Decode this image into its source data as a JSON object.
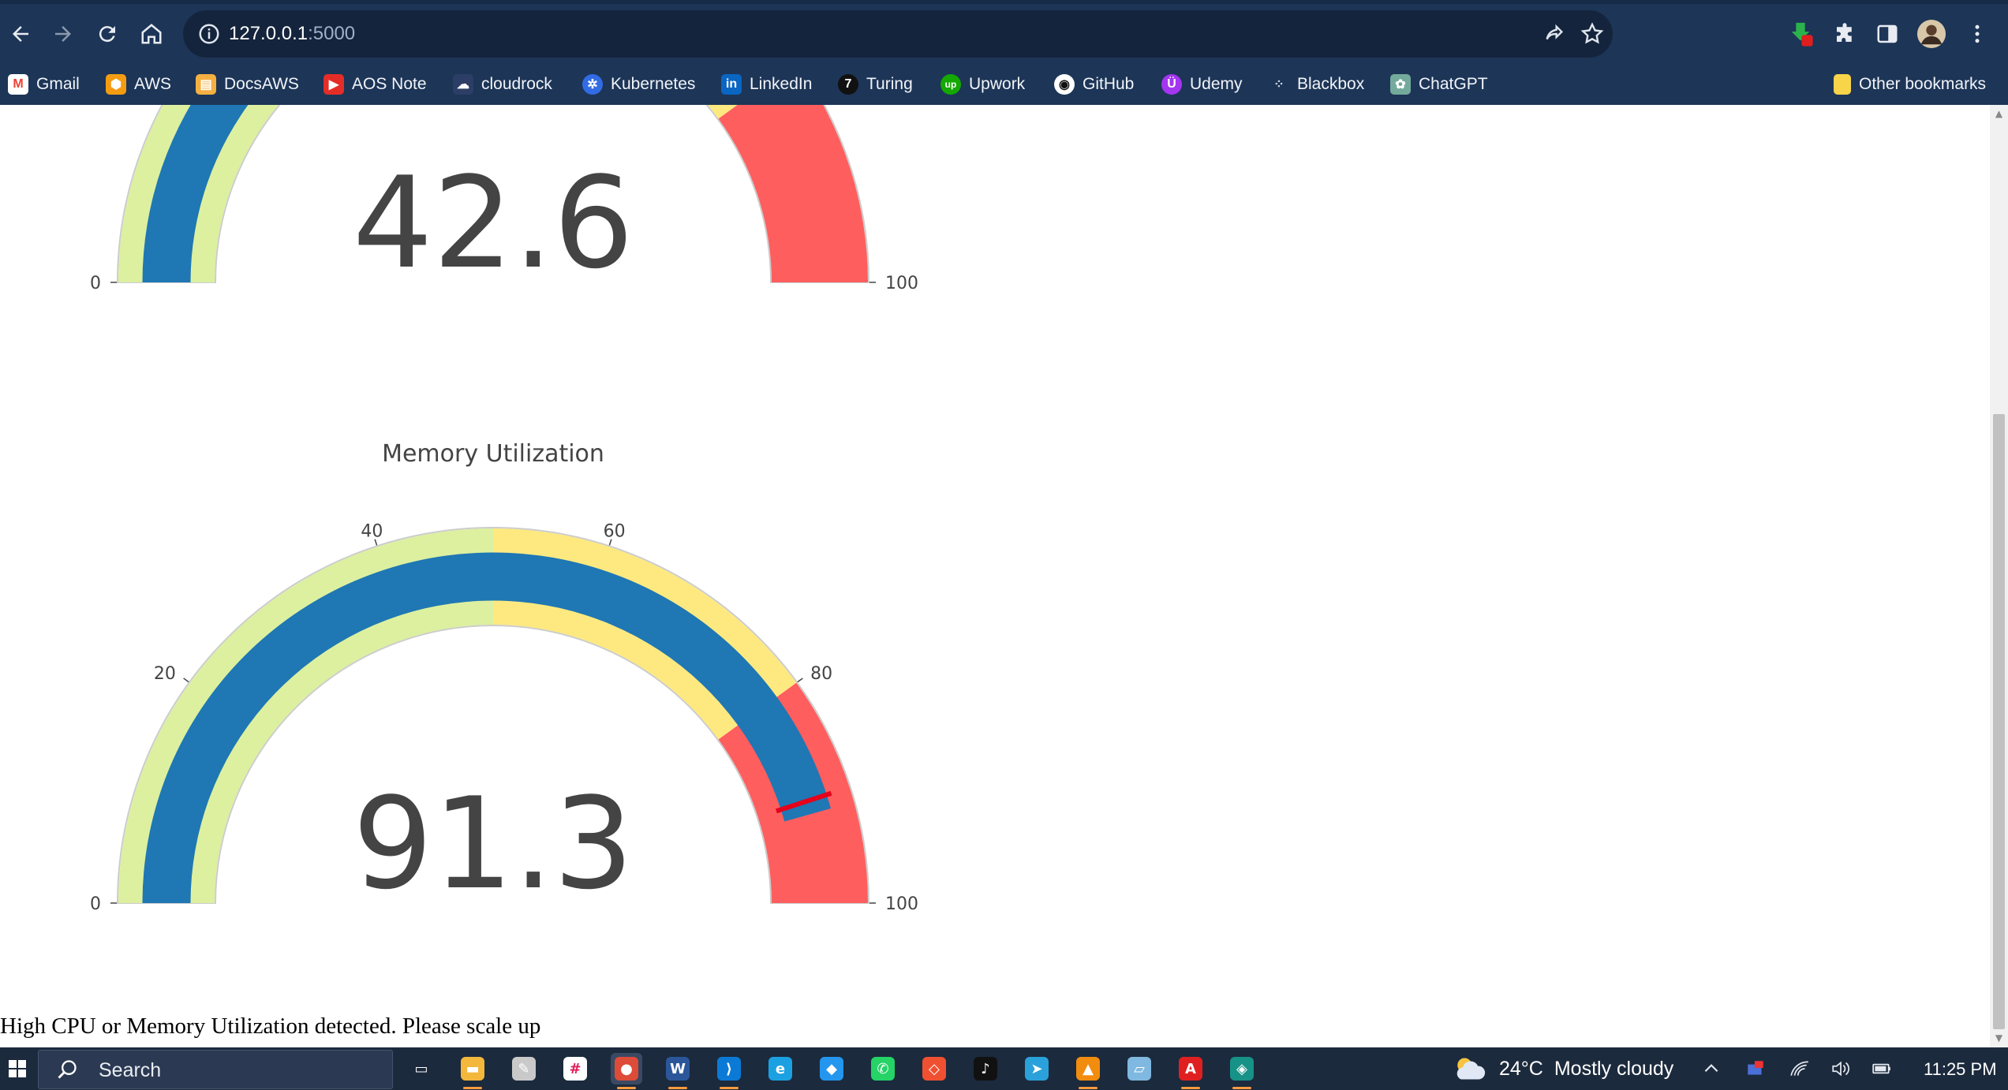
{
  "browser": {
    "url_host": "127.0.0.1",
    "url_port": ":5000",
    "bookmarks": [
      {
        "label": "Gmail",
        "icon": "gmail-icon",
        "color": "#ea4335"
      },
      {
        "label": "AWS",
        "icon": "aws-icon",
        "color": "#f39c12"
      },
      {
        "label": "DocsAWS",
        "icon": "docs-aws-icon",
        "color": "#f5b041"
      },
      {
        "label": "AOS Note",
        "icon": "youtube-icon",
        "color": "#e52d27"
      },
      {
        "label": "cloudrock",
        "icon": "cloudrock-icon",
        "color": "#2c3e66"
      },
      {
        "label": "Kubernetes",
        "icon": "kubernetes-icon",
        "color": "#326ce5"
      },
      {
        "label": "LinkedIn",
        "icon": "linkedin-icon",
        "color": "#0a66c2"
      },
      {
        "label": "Turing",
        "icon": "turing-icon",
        "color": "#111111"
      },
      {
        "label": "Upwork",
        "icon": "upwork-icon",
        "color": "#14a800"
      },
      {
        "label": "GitHub",
        "icon": "github-icon",
        "color": "#ffffff"
      },
      {
        "label": "Udemy",
        "icon": "udemy-icon",
        "color": "#a435f0"
      },
      {
        "label": "Blackbox",
        "icon": "blackbox-icon",
        "color": "#cfd6e0"
      },
      {
        "label": "ChatGPT",
        "icon": "chatgpt-icon",
        "color": "#74aa9c"
      }
    ],
    "other_bookmarks": "Other bookmarks"
  },
  "page": {
    "cpu_gauge": {
      "value_text": "42.6",
      "tick_min": "0",
      "tick_max": "100"
    },
    "memory_gauge": {
      "title": "Memory Utilization",
      "value_text": "91.3",
      "ticks": [
        "0",
        "20",
        "40",
        "60",
        "80",
        "100"
      ]
    },
    "alert_text": "High CPU or Memory Utilization detected. Please scale up"
  },
  "chart_data": [
    {
      "type": "gauge",
      "title": "",
      "value": 42.6,
      "range": [
        0,
        100
      ],
      "steps": [
        {
          "range": [
            0,
            50
          ],
          "color": "#dcf0a0"
        },
        {
          "range": [
            50,
            80
          ],
          "color": "#fde980"
        },
        {
          "range": [
            80,
            100
          ],
          "color": "#ff5e5e"
        }
      ],
      "bar_color": "#1f77b4"
    },
    {
      "type": "gauge",
      "title": "Memory Utilization",
      "value": 91.3,
      "range": [
        0,
        100
      ],
      "tick_values": [
        0,
        20,
        40,
        60,
        80,
        100
      ],
      "steps": [
        {
          "range": [
            0,
            50
          ],
          "color": "#dcf0a0"
        },
        {
          "range": [
            50,
            80
          ],
          "color": "#fde980"
        },
        {
          "range": [
            80,
            100
          ],
          "color": "#ff5e5e"
        }
      ],
      "bar_color": "#1f77b4",
      "threshold": {
        "value": 90,
        "color": "#e6001a"
      }
    }
  ],
  "taskbar": {
    "search_placeholder": "Search",
    "apps": [
      "task-view-icon",
      "file-explorer-icon",
      "paint-icon",
      "slack-icon",
      "chrome-icon",
      "word-icon",
      "vscode-icon",
      "edge-icon",
      "docker-icon",
      "whatsapp-icon",
      "git-icon",
      "tiktok-icon",
      "telegram-icon",
      "vlc-icon",
      "notepad-icon",
      "acrobat-icon",
      "gitkraken-icon"
    ],
    "weather_temp": "24°C",
    "weather_desc": "Mostly cloudy",
    "time": "11:25 PM"
  }
}
